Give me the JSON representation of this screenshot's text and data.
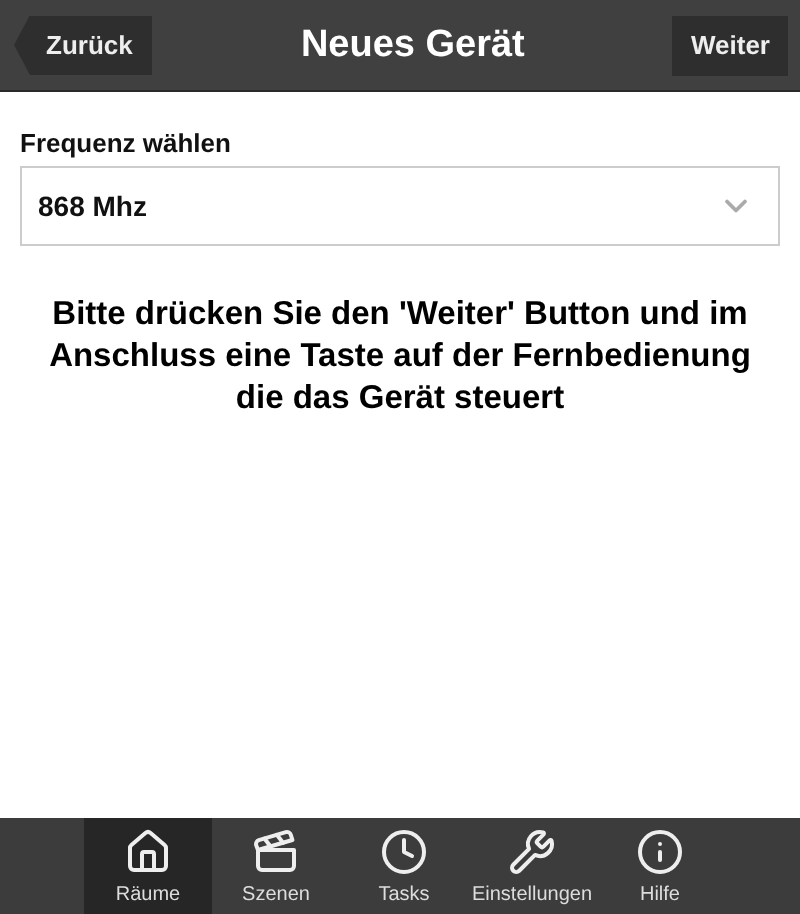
{
  "header": {
    "back": "Zurück",
    "title": "Neues Gerät",
    "next": "Weiter"
  },
  "frequency": {
    "label": "Frequenz wählen",
    "value": "868 Mhz"
  },
  "instruction": "Bitte drücken Sie den 'Weiter' Button und im Anschluss eine Taste auf der Fernbedienung die das Gerät steuert",
  "tabs": [
    {
      "kind": "rooms",
      "label": "Räume",
      "selected": true
    },
    {
      "kind": "scenes",
      "label": "Szenen",
      "selected": false
    },
    {
      "kind": "tasks",
      "label": "Tasks",
      "selected": false
    },
    {
      "kind": "settings",
      "label": "Einstellungen",
      "selected": false
    },
    {
      "kind": "help",
      "label": "Hilfe",
      "selected": false
    }
  ]
}
